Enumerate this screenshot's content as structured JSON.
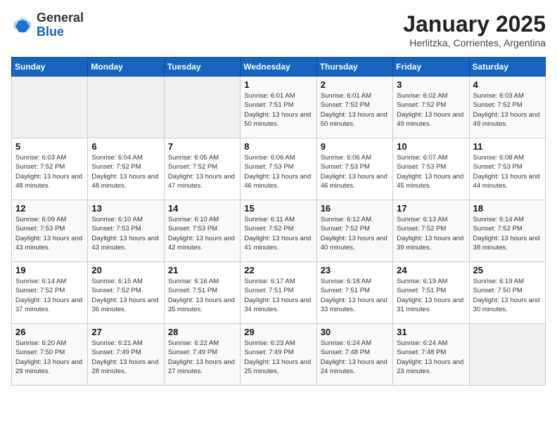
{
  "header": {
    "logo_general": "General",
    "logo_blue": "Blue",
    "month": "January 2025",
    "location": "Herlitzka, Corrientes, Argentina"
  },
  "days_of_week": [
    "Sunday",
    "Monday",
    "Tuesday",
    "Wednesday",
    "Thursday",
    "Friday",
    "Saturday"
  ],
  "weeks": [
    [
      {
        "day": "",
        "sunrise": "",
        "sunset": "",
        "daylight": ""
      },
      {
        "day": "",
        "sunrise": "",
        "sunset": "",
        "daylight": ""
      },
      {
        "day": "",
        "sunrise": "",
        "sunset": "",
        "daylight": ""
      },
      {
        "day": "1",
        "sunrise": "6:01 AM",
        "sunset": "7:51 PM",
        "daylight": "13 hours and 50 minutes."
      },
      {
        "day": "2",
        "sunrise": "6:01 AM",
        "sunset": "7:52 PM",
        "daylight": "13 hours and 50 minutes."
      },
      {
        "day": "3",
        "sunrise": "6:02 AM",
        "sunset": "7:52 PM",
        "daylight": "13 hours and 49 minutes."
      },
      {
        "day": "4",
        "sunrise": "6:03 AM",
        "sunset": "7:52 PM",
        "daylight": "13 hours and 49 minutes."
      }
    ],
    [
      {
        "day": "5",
        "sunrise": "6:03 AM",
        "sunset": "7:52 PM",
        "daylight": "13 hours and 48 minutes."
      },
      {
        "day": "6",
        "sunrise": "6:04 AM",
        "sunset": "7:52 PM",
        "daylight": "13 hours and 48 minutes."
      },
      {
        "day": "7",
        "sunrise": "6:05 AM",
        "sunset": "7:52 PM",
        "daylight": "13 hours and 47 minutes."
      },
      {
        "day": "8",
        "sunrise": "6:06 AM",
        "sunset": "7:53 PM",
        "daylight": "13 hours and 46 minutes."
      },
      {
        "day": "9",
        "sunrise": "6:06 AM",
        "sunset": "7:53 PM",
        "daylight": "13 hours and 46 minutes."
      },
      {
        "day": "10",
        "sunrise": "6:07 AM",
        "sunset": "7:53 PM",
        "daylight": "13 hours and 45 minutes."
      },
      {
        "day": "11",
        "sunrise": "6:08 AM",
        "sunset": "7:53 PM",
        "daylight": "13 hours and 44 minutes."
      }
    ],
    [
      {
        "day": "12",
        "sunrise": "6:09 AM",
        "sunset": "7:53 PM",
        "daylight": "13 hours and 43 minutes."
      },
      {
        "day": "13",
        "sunrise": "6:10 AM",
        "sunset": "7:53 PM",
        "daylight": "13 hours and 43 minutes."
      },
      {
        "day": "14",
        "sunrise": "6:10 AM",
        "sunset": "7:53 PM",
        "daylight": "13 hours and 42 minutes."
      },
      {
        "day": "15",
        "sunrise": "6:11 AM",
        "sunset": "7:52 PM",
        "daylight": "13 hours and 41 minutes."
      },
      {
        "day": "16",
        "sunrise": "6:12 AM",
        "sunset": "7:52 PM",
        "daylight": "13 hours and 40 minutes."
      },
      {
        "day": "17",
        "sunrise": "6:13 AM",
        "sunset": "7:52 PM",
        "daylight": "13 hours and 39 minutes."
      },
      {
        "day": "18",
        "sunrise": "6:14 AM",
        "sunset": "7:52 PM",
        "daylight": "13 hours and 38 minutes."
      }
    ],
    [
      {
        "day": "19",
        "sunrise": "6:14 AM",
        "sunset": "7:52 PM",
        "daylight": "13 hours and 37 minutes."
      },
      {
        "day": "20",
        "sunrise": "6:15 AM",
        "sunset": "7:52 PM",
        "daylight": "13 hours and 36 minutes."
      },
      {
        "day": "21",
        "sunrise": "6:16 AM",
        "sunset": "7:51 PM",
        "daylight": "13 hours and 35 minutes."
      },
      {
        "day": "22",
        "sunrise": "6:17 AM",
        "sunset": "7:51 PM",
        "daylight": "13 hours and 34 minutes."
      },
      {
        "day": "23",
        "sunrise": "6:18 AM",
        "sunset": "7:51 PM",
        "daylight": "13 hours and 33 minutes."
      },
      {
        "day": "24",
        "sunrise": "6:19 AM",
        "sunset": "7:51 PM",
        "daylight": "13 hours and 31 minutes."
      },
      {
        "day": "25",
        "sunrise": "6:19 AM",
        "sunset": "7:50 PM",
        "daylight": "13 hours and 30 minutes."
      }
    ],
    [
      {
        "day": "26",
        "sunrise": "6:20 AM",
        "sunset": "7:50 PM",
        "daylight": "13 hours and 29 minutes."
      },
      {
        "day": "27",
        "sunrise": "6:21 AM",
        "sunset": "7:49 PM",
        "daylight": "13 hours and 28 minutes."
      },
      {
        "day": "28",
        "sunrise": "6:22 AM",
        "sunset": "7:49 PM",
        "daylight": "13 hours and 27 minutes."
      },
      {
        "day": "29",
        "sunrise": "6:23 AM",
        "sunset": "7:49 PM",
        "daylight": "13 hours and 25 minutes."
      },
      {
        "day": "30",
        "sunrise": "6:24 AM",
        "sunset": "7:48 PM",
        "daylight": "13 hours and 24 minutes."
      },
      {
        "day": "31",
        "sunrise": "6:24 AM",
        "sunset": "7:48 PM",
        "daylight": "13 hours and 23 minutes."
      },
      {
        "day": "",
        "sunrise": "",
        "sunset": "",
        "daylight": ""
      }
    ]
  ]
}
